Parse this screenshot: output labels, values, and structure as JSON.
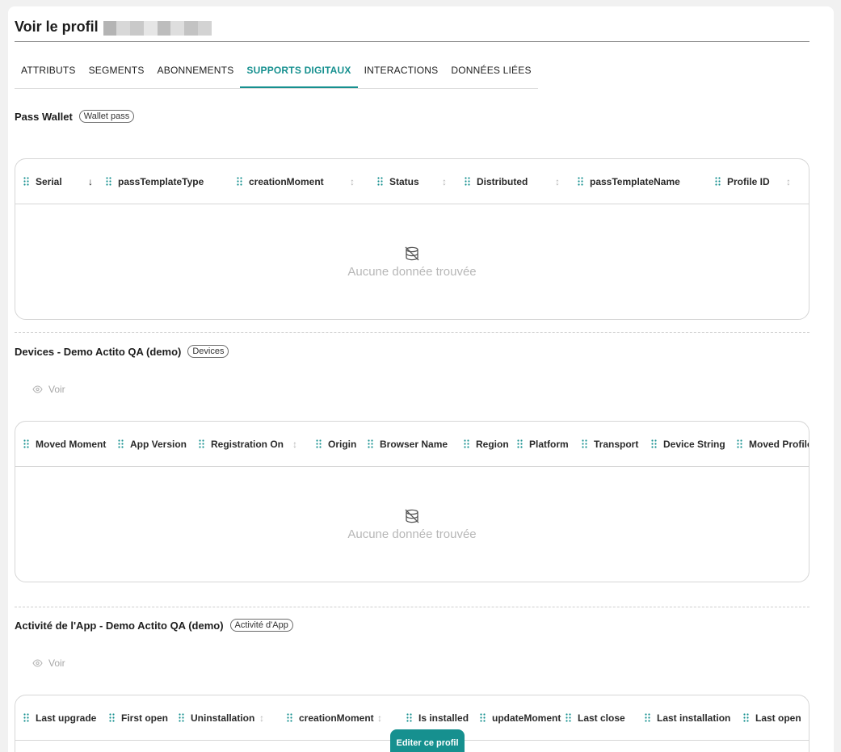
{
  "page": {
    "title": "Voir le profil",
    "masked_colors": [
      "#b4b4b4",
      "#d8d8d8",
      "#c9c9c9",
      "#e6e6e6",
      "#bdbdbd",
      "#dedede",
      "#c3c3c3",
      "#d3d3d3"
    ]
  },
  "tabs": [
    {
      "label": "ATTRIBUTS",
      "active": false
    },
    {
      "label": "SEGMENTS",
      "active": false
    },
    {
      "label": "ABONNEMENTS",
      "active": false
    },
    {
      "label": "SUPPORTS DIGITAUX",
      "active": true
    },
    {
      "label": "INTERACTIONS",
      "active": false
    },
    {
      "label": "DONNÉES LIÉES",
      "active": false
    }
  ],
  "sections": [
    {
      "title": "Pass Wallet",
      "badge": "Wallet pass",
      "columns": [
        {
          "label": "Serial",
          "sort": "desc"
        },
        {
          "label": "passTemplateType",
          "sort": ""
        },
        {
          "label": "creationMoment",
          "sort": "both"
        },
        {
          "label": "Status",
          "sort": "both"
        },
        {
          "label": "Distributed",
          "sort": "both"
        },
        {
          "label": "passTemplateName",
          "sort": ""
        },
        {
          "label": "Profile ID",
          "sort": "both"
        }
      ],
      "empty_text": "Aucune donnée trouvée"
    },
    {
      "title": "Devices - Demo Actito QA (demo)",
      "badge": "Devices",
      "view_label": "Voir",
      "columns": [
        {
          "label": "Moved Moment",
          "sort": ""
        },
        {
          "label": "App Version",
          "sort": ""
        },
        {
          "label": "Registration On",
          "sort": "both"
        },
        {
          "label": "Origin",
          "sort": ""
        },
        {
          "label": "Browser Name",
          "sort": ""
        },
        {
          "label": "Region",
          "sort": ""
        },
        {
          "label": "Platform",
          "sort": ""
        },
        {
          "label": "Transport",
          "sort": ""
        },
        {
          "label": "Device String",
          "sort": ""
        },
        {
          "label": "Moved Profile",
          "sort": ""
        }
      ],
      "empty_text": "Aucune donnée trouvée"
    },
    {
      "title": "Activité de l'App - Demo Actito QA (demo)",
      "badge": "Activité d'App",
      "view_label": "Voir",
      "columns": [
        {
          "label": "Last upgrade",
          "sort": ""
        },
        {
          "label": "First open",
          "sort": ""
        },
        {
          "label": "Uninstallation",
          "sort": "both"
        },
        {
          "label": "creationMoment",
          "sort": "both"
        },
        {
          "label": "Is installed",
          "sort": ""
        },
        {
          "label": "updateMoment",
          "sort": ""
        },
        {
          "label": "Last close",
          "sort": ""
        },
        {
          "label": "Last installation",
          "sort": ""
        },
        {
          "label": "Last open",
          "sort": ""
        }
      ]
    }
  ],
  "icons": {
    "grip": "drag-handle-icon",
    "sort_both": "sort-both-icon",
    "sort_desc": "sort-desc-icon",
    "empty": "no-database-icon",
    "eye": "eye-icon"
  },
  "colors": {
    "accent": "#16908f",
    "border": "#d6d6d6",
    "muted": "#b7b7b7"
  },
  "fab": {
    "label": "Editer ce profil"
  }
}
